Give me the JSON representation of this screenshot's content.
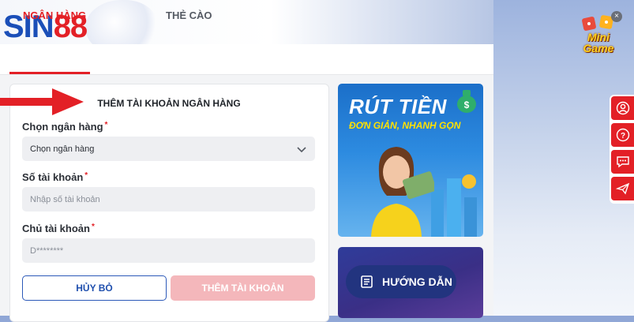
{
  "brand": {
    "logo_part1": "SIN",
    "logo_part2": "88"
  },
  "tabs": [
    {
      "label": "NGÂN HÀNG",
      "active": true
    },
    {
      "label": "THẺ CÀO",
      "active": false
    }
  ],
  "form": {
    "title": "THÊM TÀI KHOẢN NGÂN HÀNG",
    "bank": {
      "label": "Chọn ngân hàng",
      "value": "Chọn ngân hàng"
    },
    "account_number": {
      "label": "Số tài khoản",
      "placeholder": "Nhập số tài khoản"
    },
    "account_holder": {
      "label": "Chủ tài khoản",
      "value": "D********"
    },
    "required_mark": "*",
    "cancel_label": "HỦY BỎ",
    "submit_label": "THÊM TÀI KHOẢN"
  },
  "promo": {
    "title": "RÚT TIỀN",
    "subtitle": "ĐƠN GIẢN, NHANH GỌN"
  },
  "guide": {
    "label": "HƯỚNG DẪN"
  },
  "minigame": {
    "line1": "Mini",
    "line2": "Game",
    "close": "×"
  },
  "side_menu": [
    {
      "icon": "user-icon"
    },
    {
      "icon": "help-icon"
    },
    {
      "icon": "chat-icon"
    },
    {
      "icon": "telegram-icon"
    }
  ],
  "colors": {
    "accent": "#e32026",
    "brand_blue": "#1b4fb8",
    "button_disabled": "#f4b7bb"
  }
}
